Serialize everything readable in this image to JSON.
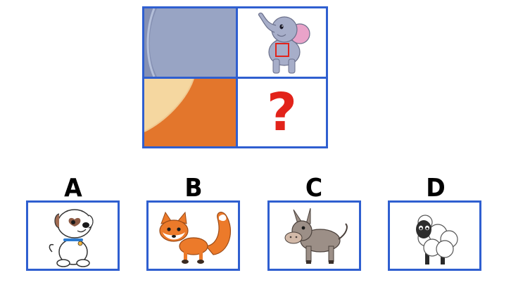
{
  "puzzle": {
    "question_mark": "?",
    "colors": {
      "grid_border": "#2f5fd0",
      "elephant_skin_sample": "#98a4c4",
      "fox_fur_sample": "#e3762c",
      "question_mark": "#e2231a",
      "highlight_box": "#e2231a"
    },
    "cells": [
      {
        "content": "gray-color-swatch"
      },
      {
        "content": "elephant-icon"
      },
      {
        "content": "orange-color-swatch"
      },
      {
        "content": "question-mark"
      }
    ]
  },
  "options": [
    {
      "letter": "A",
      "animal": "dog-icon"
    },
    {
      "letter": "B",
      "animal": "fox-icon"
    },
    {
      "letter": "C",
      "animal": "donkey-icon"
    },
    {
      "letter": "D",
      "animal": "sheep-icon"
    }
  ]
}
